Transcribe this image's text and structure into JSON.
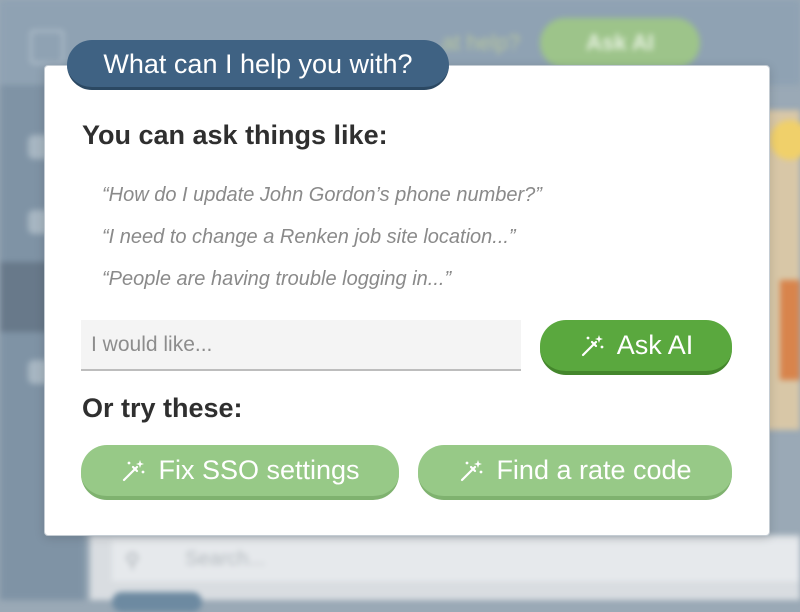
{
  "background": {
    "help_text": "…at help?",
    "ask_ai_label": "Ask AI",
    "search_placeholder": "Search..."
  },
  "modal": {
    "title": "What can I help you with?",
    "heading": "You can ask things like:",
    "examples": [
      "“How do I update John Gordon’s phone number?”",
      "“I need to change a Renken job site location...”",
      "“People are having trouble logging in...”"
    ],
    "input": {
      "placeholder": "I would like...",
      "value": ""
    },
    "ask_button_label": "Ask AI",
    "suggestions_heading": "Or try these:",
    "suggestions": [
      {
        "label": "Fix SSO settings"
      },
      {
        "label": "Find a rate code"
      }
    ]
  },
  "icons": {
    "button_icon": "magic-wand-icon",
    "search": "search-icon"
  },
  "colors": {
    "title_pill": "#3f6283",
    "primary_button": "#5aa83e",
    "suggestion_button": "#97c987"
  }
}
